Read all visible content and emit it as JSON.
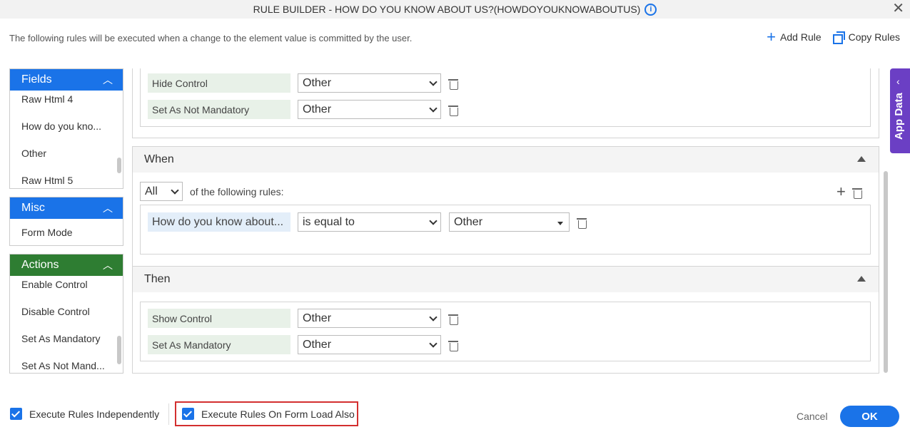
{
  "dialog": {
    "title": "RULE BUILDER - HOW DO YOU KNOW ABOUT US?(HOWDOYOUKNOWABOUTUS)",
    "subtitle": "The following rules will be executed when a change to the element value is committed by the user.",
    "add_rule_label": "Add Rule",
    "copy_rules_label": "Copy Rules"
  },
  "sidebar": {
    "fields": {
      "title": "Fields",
      "color": "#1a73e8",
      "items": [
        "Raw Html 4",
        "How do you kno...",
        "Other",
        "Raw Html 5"
      ]
    },
    "misc": {
      "title": "Misc",
      "color": "#1a73e8",
      "items": [
        "Form Mode"
      ]
    },
    "actions": {
      "title": "Actions",
      "color": "#2e7d32",
      "items": [
        "Enable Control",
        "Disable Control",
        "Set As Mandatory",
        "Set As Not Mand..."
      ]
    }
  },
  "top_actions": [
    {
      "action": "Hide Control",
      "target": "Other"
    },
    {
      "action": "Set As Not Mandatory",
      "target": "Other"
    }
  ],
  "when": {
    "title": "When",
    "quantifier": "All",
    "quantifier_suffix": "of the following rules:",
    "condition": {
      "field": "How do you know about...",
      "operator": "is equal to",
      "value": "Other"
    }
  },
  "then": {
    "title": "Then",
    "actions": [
      {
        "action": "Show Control",
        "target": "Other"
      },
      {
        "action": "Set As Mandatory",
        "target": "Other"
      }
    ]
  },
  "app_data_label": "App Data",
  "footer": {
    "execute_independently": "Execute Rules Independently",
    "execute_on_load": "Execute Rules On Form Load Also",
    "cancel": "Cancel",
    "ok": "OK"
  }
}
